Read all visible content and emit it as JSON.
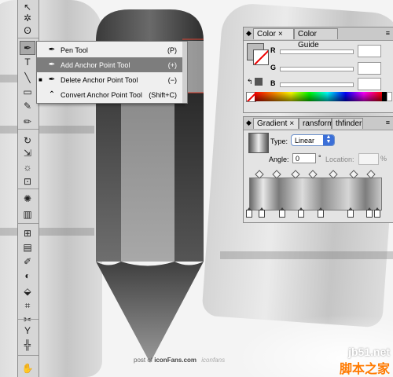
{
  "tools_panel": {
    "tools": [
      {
        "name": "selection-tool-icon",
        "glyph": "↖"
      },
      {
        "name": "magic-wand-icon",
        "glyph": "✲"
      },
      {
        "name": "lasso-icon",
        "glyph": "ʘ"
      },
      {
        "name": "pen-tool-icon",
        "glyph": "✒"
      },
      {
        "name": "type-tool-icon",
        "glyph": "T"
      },
      {
        "name": "line-tool-icon",
        "glyph": "╲"
      },
      {
        "name": "rectangle-tool-icon",
        "glyph": "▭"
      },
      {
        "name": "paintbrush-icon",
        "glyph": "✎"
      },
      {
        "name": "pencil-tool-icon",
        "glyph": "✏"
      },
      {
        "name": "rotate-tool-icon",
        "glyph": "↻"
      },
      {
        "name": "scale-tool-icon",
        "glyph": "⇲"
      },
      {
        "name": "warp-tool-icon",
        "glyph": "☼"
      },
      {
        "name": "free-transform-icon",
        "glyph": "⊡"
      },
      {
        "name": "symbol-sprayer-icon",
        "glyph": "✺"
      },
      {
        "name": "column-graph-icon",
        "glyph": "▥"
      },
      {
        "name": "mesh-tool-icon",
        "glyph": "⊞"
      },
      {
        "name": "gradient-tool-icon",
        "glyph": "▤"
      },
      {
        "name": "eyedropper-icon",
        "glyph": "✐"
      },
      {
        "name": "blend-tool-icon",
        "glyph": "◐"
      },
      {
        "name": "live-paint-icon",
        "glyph": "⬙"
      },
      {
        "name": "crop-area-icon",
        "glyph": "⌗"
      },
      {
        "name": "slice-tool-icon",
        "glyph": "✂"
      },
      {
        "name": "perspective-icon",
        "glyph": "Y"
      },
      {
        "name": "artboard-icon",
        "glyph": "╬"
      },
      {
        "name": "hand-tool-icon",
        "glyph": "✋"
      }
    ]
  },
  "flyout_menu": {
    "items": [
      {
        "label": "Pen Tool",
        "shortcut": "(P)",
        "icon": "pen-icon",
        "glyph": "✒",
        "highlighted": false,
        "checked": false
      },
      {
        "label": "Add Anchor Point Tool",
        "shortcut": "(+)",
        "icon": "add-anchor-point-icon",
        "glyph": "✒",
        "highlighted": true,
        "checked": false
      },
      {
        "label": "Delete Anchor Point Tool",
        "shortcut": "(−)",
        "icon": "delete-anchor-point-icon",
        "glyph": "✒",
        "highlighted": false,
        "checked": true
      },
      {
        "label": "Convert Anchor Point Tool",
        "shortcut": "(Shift+C)",
        "icon": "convert-anchor-point-icon",
        "glyph": "⌃",
        "highlighted": false,
        "checked": false
      }
    ],
    "check_glyph": "■"
  },
  "color_panel": {
    "tabs": [
      "Color",
      "Color Guide"
    ],
    "active_tab": "Color",
    "close_glyph": "×",
    "channels": [
      "R",
      "G",
      "B"
    ]
  },
  "gradient_panel": {
    "tabs": [
      "Gradient",
      "ransform",
      "thfinder"
    ],
    "active_tab": "Gradient",
    "close_glyph": "×",
    "type_label": "Type:",
    "type_value": "Linear",
    "angle_label": "Angle:",
    "angle_value": "0",
    "degree_symbol": "°",
    "location_label": "Location:",
    "percent_symbol": "%"
  },
  "credit": {
    "prefix": "post of ",
    "site": "iconFans.com",
    "logo": "iconfans"
  },
  "watermark": {
    "site": "jb51.net",
    "cn": "脚本之家"
  },
  "colors": {
    "highlight": "#7d7d7d",
    "panel_bg": "#e4e4e4",
    "accent_blue": "#3b6fd8",
    "watermark_orange": "#ff7a00"
  }
}
